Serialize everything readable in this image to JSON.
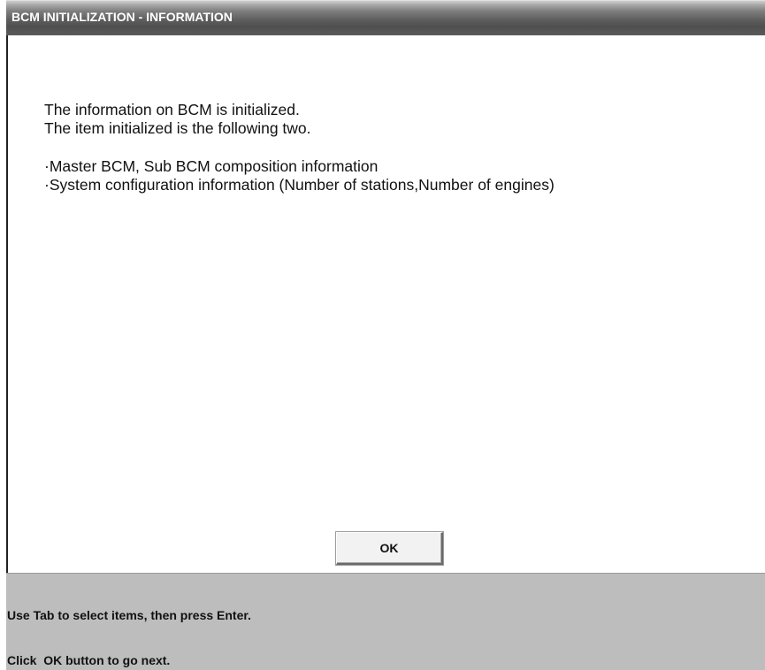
{
  "window": {
    "title": "BCM INITIALIZATION - INFORMATION"
  },
  "message": {
    "line1": "The information on BCM is initialized.",
    "line2": "The item initialized is the following two.",
    "item1": "·Master BCM, Sub BCM composition information",
    "item2": "·System configuration information (Number of stations,Number of engines)"
  },
  "buttons": {
    "ok_label": "OK"
  },
  "status": {
    "line1": "Use Tab to select items, then press Enter.",
    "line2": "Click  OK button to go next."
  },
  "colors": {
    "title_bar": "#5a5a5a",
    "title_text": "#ffffff",
    "content_bg": "#ffffff",
    "status_bg": "#bdbdbd"
  }
}
